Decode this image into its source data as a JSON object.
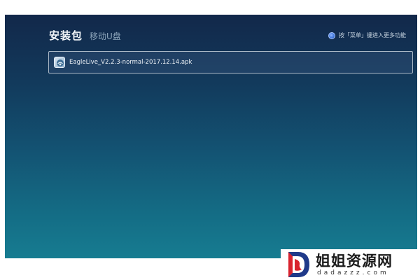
{
  "header": {
    "active_tab": "安装包",
    "inactive_tab": "移动U盘"
  },
  "hint": {
    "icon": "menu-button-icon",
    "text": "按「菜单」键进入更多功能"
  },
  "files": [
    {
      "icon": "apk-app-icon",
      "name": "EagleLive_V2.2.3-normal-2017.12.14.apk",
      "selected": true
    }
  ],
  "watermark": {
    "title": "姐姐资源网",
    "domain": "dadazzz.com"
  },
  "colors": {
    "screen_top": "#12284a",
    "screen_bottom": "#167c91",
    "logo_red": "#d9232e",
    "logo_blue": "#1f3a8a"
  }
}
